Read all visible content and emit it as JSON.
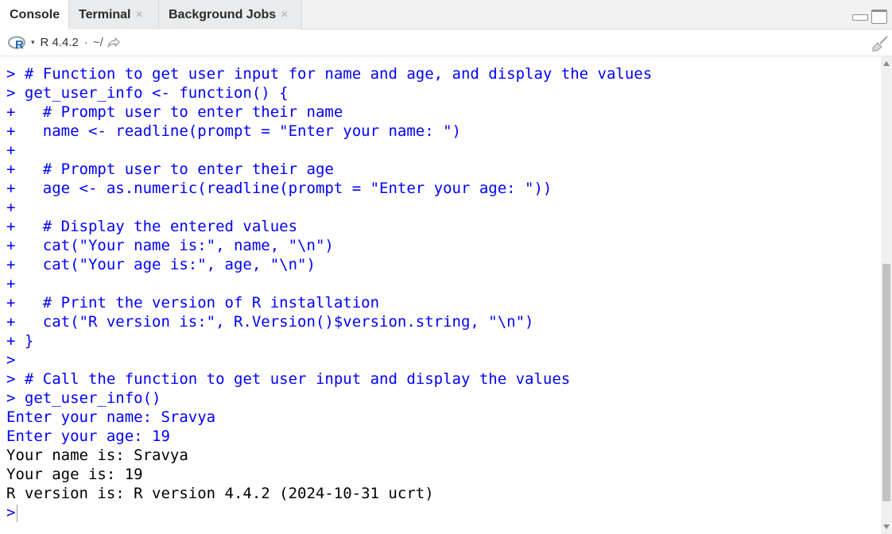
{
  "tabs": [
    {
      "label": "Console",
      "closable": false,
      "active": true
    },
    {
      "label": "Terminal",
      "closable": true,
      "active": false
    },
    {
      "label": "Background Jobs",
      "closable": true,
      "active": false
    }
  ],
  "tab_close_glyph": "×",
  "infobar": {
    "r_icon": "r-logo-icon",
    "caret": "▾",
    "version": "R 4.4.2",
    "separator": "·",
    "path": "~/"
  },
  "colors": {
    "input": "#0000ff",
    "output": "#000000",
    "r_logo_blue": "#2166b6"
  },
  "console": {
    "lines": [
      {
        "prompt": ">",
        "text": " # Function to get user input for name and age, and display the values",
        "type": "input"
      },
      {
        "prompt": ">",
        "text": " get_user_info <- function() {",
        "type": "input"
      },
      {
        "prompt": "+",
        "text": "   # Prompt user to enter their name",
        "type": "input"
      },
      {
        "prompt": "+",
        "text": "   name <- readline(prompt = \"Enter your name: \")",
        "type": "input"
      },
      {
        "prompt": "+",
        "text": "",
        "type": "input"
      },
      {
        "prompt": "+",
        "text": "   # Prompt user to enter their age",
        "type": "input"
      },
      {
        "prompt": "+",
        "text": "   age <- as.numeric(readline(prompt = \"Enter your age: \"))",
        "type": "input"
      },
      {
        "prompt": "+",
        "text": "",
        "type": "input"
      },
      {
        "prompt": "+",
        "text": "   # Display the entered values",
        "type": "input"
      },
      {
        "prompt": "+",
        "text": "   cat(\"Your name is:\", name, \"\\n\")",
        "type": "input"
      },
      {
        "prompt": "+",
        "text": "   cat(\"Your age is:\", age, \"\\n\")",
        "type": "input"
      },
      {
        "prompt": "+",
        "text": "",
        "type": "input"
      },
      {
        "prompt": "+",
        "text": "   # Print the version of R installation",
        "type": "input"
      },
      {
        "prompt": "+",
        "text": "   cat(\"R version is:\", R.Version()$version.string, \"\\n\")",
        "type": "input"
      },
      {
        "prompt": "+",
        "text": " }",
        "type": "input"
      },
      {
        "prompt": ">",
        "text": "",
        "type": "input"
      },
      {
        "prompt": ">",
        "text": " # Call the function to get user input and display the values",
        "type": "input"
      },
      {
        "prompt": ">",
        "text": " get_user_info()",
        "type": "input"
      },
      {
        "prompt": "",
        "text": "Enter your name: Sravya",
        "type": "input"
      },
      {
        "prompt": "",
        "text": "Enter your age: 19",
        "type": "input"
      },
      {
        "prompt": "",
        "text": "Your name is: Sravya",
        "type": "output"
      },
      {
        "prompt": "",
        "text": "Your age is: 19",
        "type": "output"
      },
      {
        "prompt": "",
        "text": "R version is: R version 4.4.2 (2024-10-31 ucrt)",
        "type": "output"
      }
    ],
    "current_prompt": ">"
  },
  "scroll": {
    "thumb_fraction_start": 0.43,
    "thumb_fraction_size": 0.53
  }
}
